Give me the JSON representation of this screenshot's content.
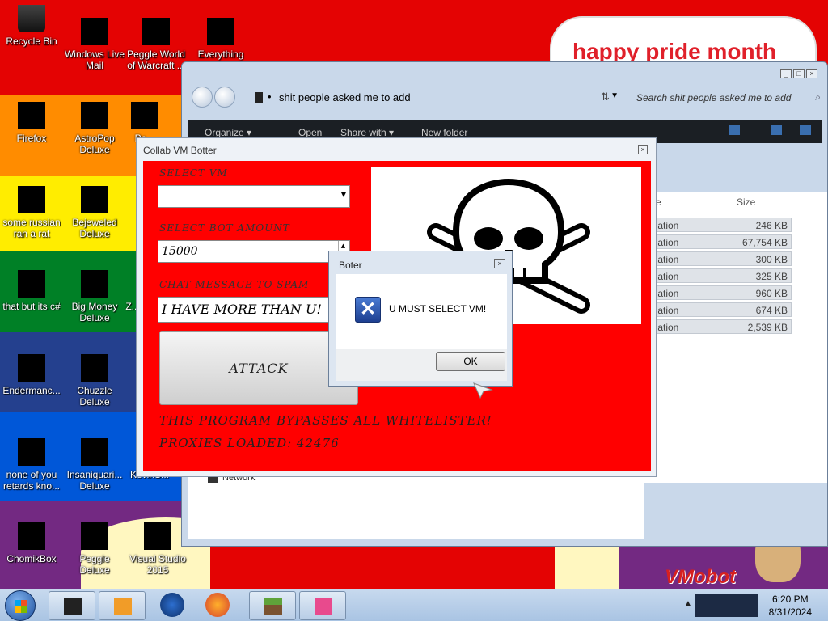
{
  "desktop": {
    "icons": [
      {
        "label": "Recycle Bin"
      },
      {
        "label": "Windows Live Mail"
      },
      {
        "label": "Peggle World of Warcraft ..."
      },
      {
        "label": "Everything"
      },
      {
        "label": "Firefox"
      },
      {
        "label": "AstroPop Deluxe"
      },
      {
        "label": "Pe..."
      },
      {
        "label": "some russian ran a rat"
      },
      {
        "label": "Bejeweled Deluxe"
      },
      {
        "label": "that but its c#"
      },
      {
        "label": "Big Money Deluxe"
      },
      {
        "label": "Z..."
      },
      {
        "label": "Endermanc..."
      },
      {
        "label": "Chuzzle Deluxe"
      },
      {
        "label": "none of you retards kno..."
      },
      {
        "label": "Insaniquari... Deluxe"
      },
      {
        "label": "KevinS..."
      },
      {
        "label": "ChomikBox"
      },
      {
        "label": "Peggle Deluxe"
      },
      {
        "label": "Visual Studio 2015"
      }
    ],
    "banner_text": "happy pride month",
    "corner_text": "VMobot"
  },
  "explorer": {
    "path": "shit people asked me to add",
    "search_placeholder": "Search shit people asked me to add",
    "toolbar": {
      "organize": "Organize ▾",
      "open": "Open",
      "share": "Share with ▾",
      "new_folder": "New folder"
    },
    "columns": {
      "type": "e",
      "size": "Size"
    },
    "rows": [
      {
        "type": "lication",
        "size": "246 KB"
      },
      {
        "type": "lication",
        "size": "67,754 KB"
      },
      {
        "type": "lication",
        "size": "300 KB"
      },
      {
        "type": "lication",
        "size": "325 KB"
      },
      {
        "type": "lication",
        "size": "960 KB"
      },
      {
        "type": "lication",
        "size": "674 KB"
      },
      {
        "type": "lication",
        "size": "2,539 KB"
      }
    ],
    "network_label": "Network"
  },
  "botter": {
    "title": "Collab VM Botter",
    "select_vm_label": "SELECT VM",
    "select_vm_value": "",
    "bot_amount_label": "SELECT BOT AMOUNT",
    "bot_amount_value": "15000",
    "chat_label": "CHAT MESSAGE TO SPAM",
    "chat_value": "I HAVE MORE THAN U!",
    "attack_label": "ATTACK",
    "bypass_text": "THIS PROGRAM BYPASSES ALL WHITELISTER!",
    "proxies_text": "PROXIES LOADED: 42476"
  },
  "dialog": {
    "title": "Boter",
    "message": "U MUST SELECT VM!",
    "ok_label": "OK"
  },
  "taskbar": {
    "time": "6:20 PM",
    "date": "8/31/2024"
  }
}
